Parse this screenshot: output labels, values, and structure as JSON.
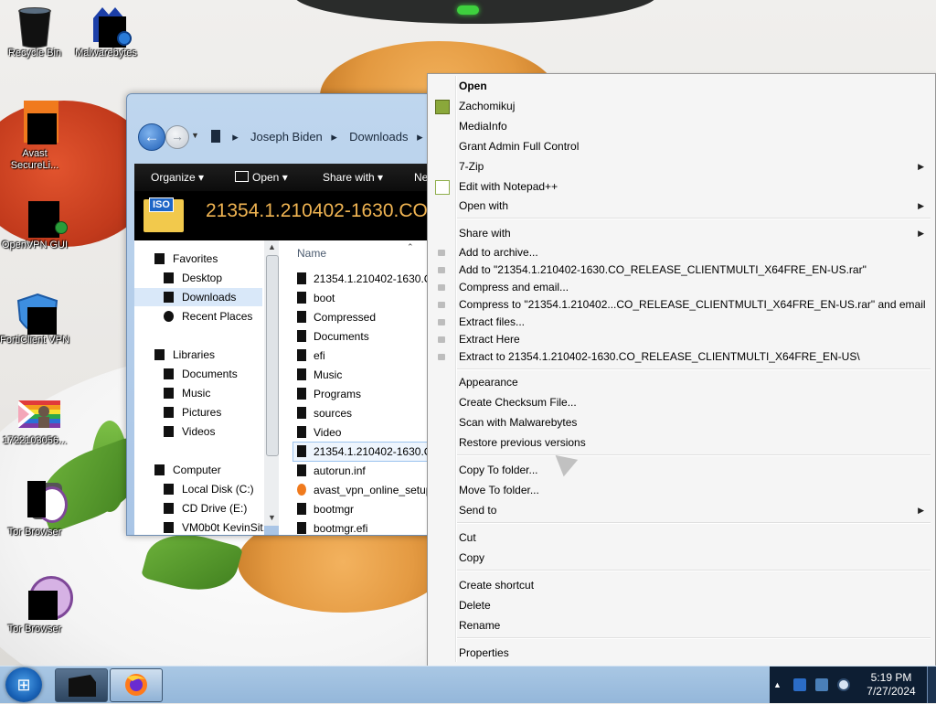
{
  "desktop": {
    "icons": [
      {
        "label": "Recycle Bin"
      },
      {
        "label": "Malwarebytes"
      },
      {
        "label": "Avast SecureLi..."
      },
      {
        "label": "OpenVPN GUI"
      },
      {
        "label": "FortiClient VPN"
      },
      {
        "label": "1722103056..."
      },
      {
        "label": "Tor Browser"
      },
      {
        "label": "Tor Browser"
      }
    ]
  },
  "explorer": {
    "breadcrumb": [
      "Joseph Biden",
      "Downloads"
    ],
    "toolbar": {
      "organize": "Organize",
      "open": "Open",
      "share_with": "Share with",
      "new_folder": "Ne"
    },
    "header_title": "21354.1.210402-1630.CO...",
    "iso_tag": "ISO",
    "nav": {
      "favorites": "Favorites",
      "desktop": "Desktop",
      "downloads": "Downloads",
      "recent_places": "Recent Places",
      "libraries": "Libraries",
      "documents": "Documents",
      "music": "Music",
      "pictures": "Pictures",
      "videos": "Videos",
      "computer": "Computer",
      "local_disk": "Local Disk (C:)",
      "cd_drive": "CD Drive (E:)",
      "vm": "VM0b0t KevinSit..."
    },
    "column_name": "Name",
    "files": [
      "21354.1.210402-1630.CO",
      "boot",
      "Compressed",
      "Documents",
      "efi",
      "Music",
      "Programs",
      "sources",
      "Video",
      "21354.1.210402-1630.CO",
      "autorun.inf",
      "avast_vpn_online_setup",
      "bootmgr",
      "bootmgr.efi"
    ]
  },
  "context_menu": {
    "items": [
      "Open",
      "Zachomikuj",
      "MediaInfo",
      "Grant Admin Full Control",
      "7-Zip",
      "Edit with Notepad++",
      "Open with",
      "Share with",
      "Add to archive...",
      "Add to \"21354.1.210402-1630.CO_RELEASE_CLIENTMULTI_X64FRE_EN-US.rar\"",
      "Compress and email...",
      "Compress to \"21354.1.210402...CO_RELEASE_CLIENTMULTI_X64FRE_EN-US.rar\" and email",
      "Extract files...",
      "Extract Here",
      "Extract to 21354.1.210402-1630.CO_RELEASE_CLIENTMULTI_X64FRE_EN-US\\",
      "Appearance",
      "Create Checksum File...",
      "Scan with Malwarebytes",
      "Restore previous versions",
      "Copy To folder...",
      "Move To folder...",
      "Send to",
      "Cut",
      "Copy",
      "Create shortcut",
      "Delete",
      "Rename",
      "Properties"
    ]
  },
  "taskbar": {
    "time": "5:19 PM",
    "date": "7/27/2024"
  },
  "colors": {
    "context_bg": "#f5f5f5",
    "taskbar": "#a9c7e4",
    "explorer_header": "#000000",
    "title_accent": "#f0b452"
  }
}
